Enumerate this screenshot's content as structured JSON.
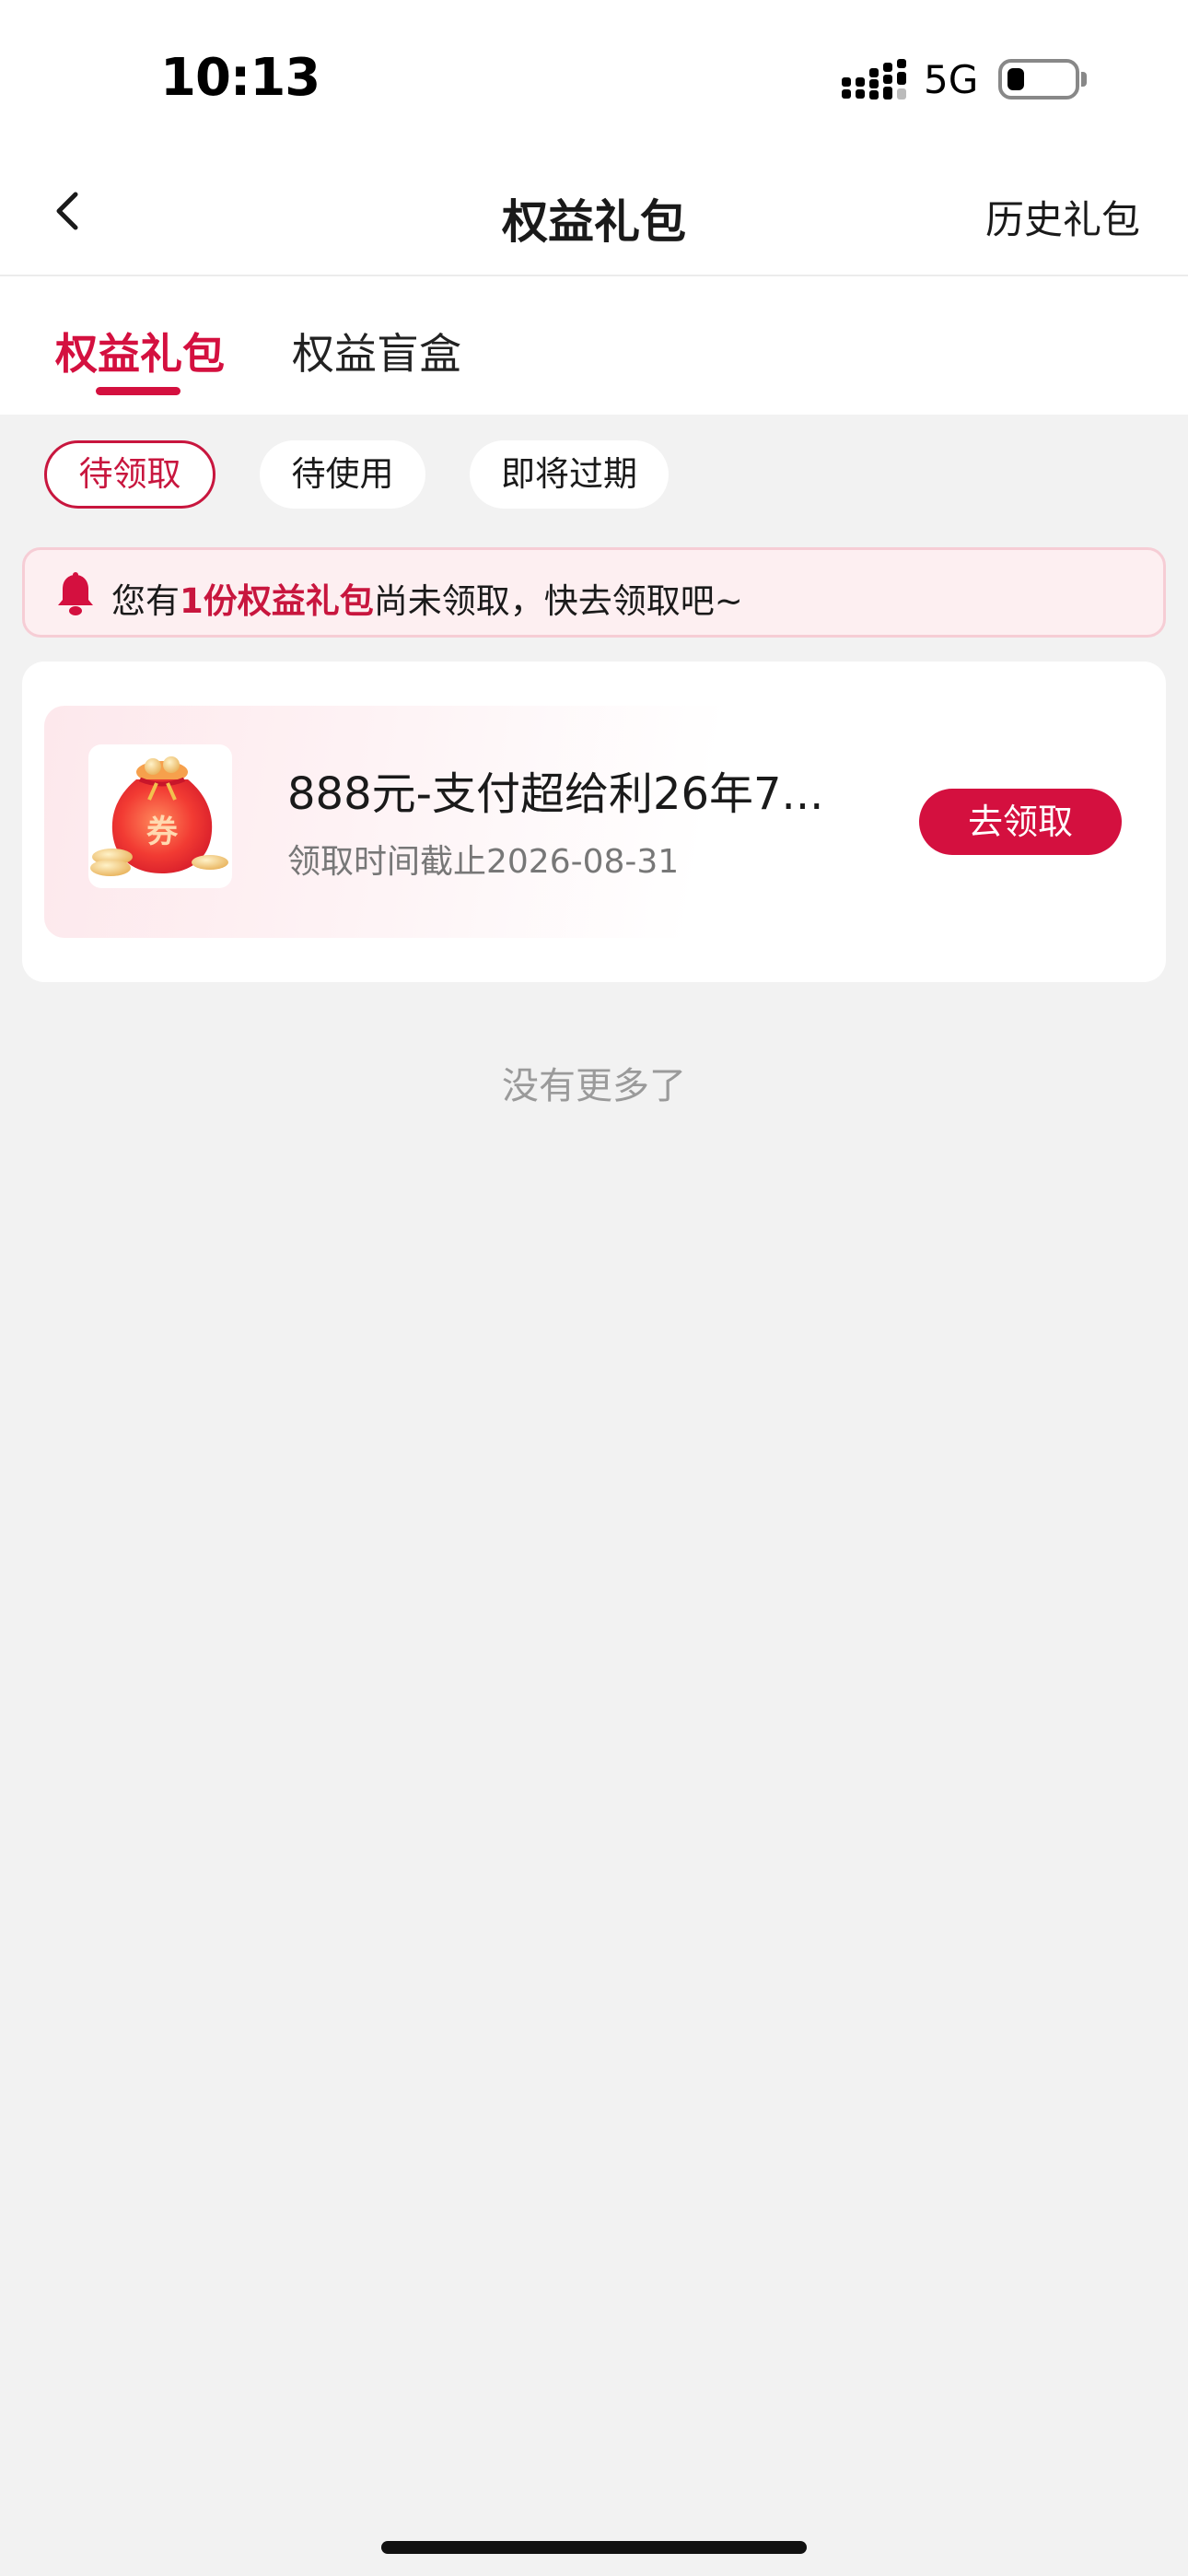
{
  "status_bar": {
    "time": "10:13",
    "network": "5G",
    "icons": [
      "signal-icon",
      "battery-icon"
    ]
  },
  "navbar": {
    "back_icon": "chevron-left-icon",
    "title": "权益礼包",
    "right_link": "历史礼包"
  },
  "tabs": [
    {
      "label": "权益礼包",
      "active": true
    },
    {
      "label": "权益盲盒",
      "active": false
    }
  ],
  "filters": [
    {
      "label": "待领取",
      "active": true
    },
    {
      "label": "待使用",
      "active": false
    },
    {
      "label": "即将过期",
      "active": false
    }
  ],
  "notice": {
    "icon": "bell-icon",
    "prefix": "您有",
    "highlight": "1份权益礼包",
    "suffix": "尚未领取，快去领取吧~"
  },
  "items": [
    {
      "icon": "red-envelope-coupon-icon",
      "thumb_text": "券",
      "title": "888元-支付超给利26年7...",
      "deadline": "领取时间截止2026-08-31",
      "button": "去领取"
    }
  ],
  "footer": {
    "no_more": "没有更多了"
  },
  "colors": {
    "accent": "#d4103f",
    "notice_bg": "#fdeff1",
    "page_bg": "#f2f2f2"
  }
}
